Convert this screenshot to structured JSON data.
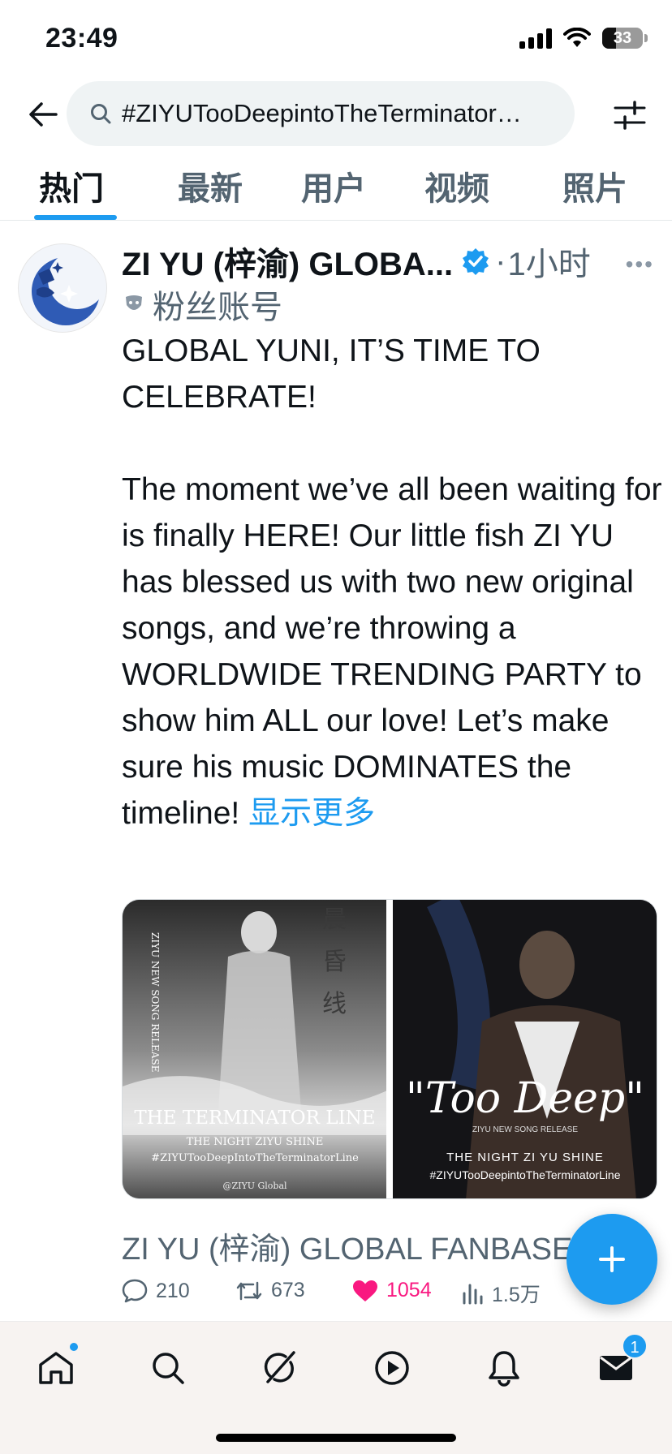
{
  "status_bar": {
    "time": "23:49",
    "battery": "33",
    "battery_level": 0.33,
    "icons": [
      "signal-icon",
      "wifi-icon",
      "battery-icon"
    ]
  },
  "search": {
    "query": "#ZIYUTooDeepintoTheTerminator…",
    "icons": [
      "back-arrow-icon",
      "search-icon",
      "filter-icon"
    ]
  },
  "tabs": [
    {
      "label": "热门",
      "active": true
    },
    {
      "label": "最新",
      "active": false
    },
    {
      "label": "用户",
      "active": false
    },
    {
      "label": "视频",
      "active": false
    },
    {
      "label": "照片",
      "active": false
    }
  ],
  "tweet": {
    "author": "ZI YU (梓渝) GLOBA...",
    "verified": true,
    "separator": "·",
    "time": "1小时",
    "account_type": "粉丝账号",
    "text_p1": "GLOBAL YUNI, IT’S TIME TO CELEBRATE!",
    "text_p2": "The moment we’ve all been waiting for is finally HERE! Our little fish ZI YU has blessed us with two new original songs, and we’re throwing a WORLDWIDE TRENDING PARTY to show him ALL our love! Let’s make sure his music DOMINATES the timeline!",
    "show_more": "显示更多",
    "media": [
      {
        "vertical_title": "晨昏线",
        "side_text": "ZIYU NEW SONG RELEASE",
        "title": "THE TERMINATOR LINE",
        "subtitle": "THE NIGHT ZIYU SHINE",
        "hashtag": "#ZIYUTooDeepIntoTheTerminatorLine",
        "credit": "@ZIYU Global"
      },
      {
        "title": "\"Too Deep\"",
        "release": "ZIYU NEW SONG RELEASE",
        "subtitle": "THE NIGHT ZI YU SHINE",
        "hashtag": "#ZIYUTooDeepintoTheTerminatorLine"
      }
    ],
    "quote_preview": "ZI YU (梓渝) GLOBAL FANBASE",
    "replies": "210",
    "retweets": "673",
    "likes": "1054",
    "views": "1.5万"
  },
  "colors": {
    "accent": "#1d9bf0",
    "like": "#f91880",
    "secondary_text": "#536471"
  },
  "bottom_nav": {
    "items": [
      "home-icon",
      "search-icon",
      "grok-icon",
      "video-icon",
      "notifications-icon",
      "messages-icon"
    ],
    "messages_badge": "1"
  }
}
